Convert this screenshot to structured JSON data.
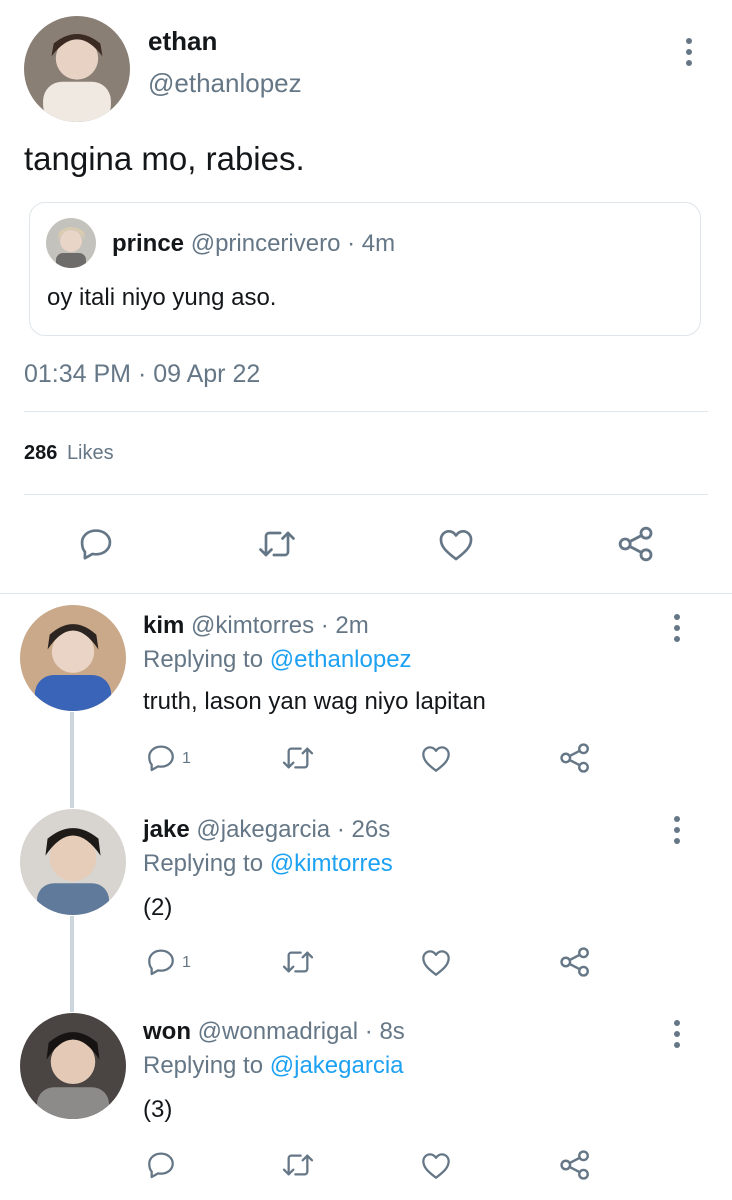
{
  "tweet": {
    "author_name": "ethan",
    "author_handle": "@ethanlopez",
    "text": "tangina mo, rabies.",
    "quote": {
      "author_name": "prince",
      "author_handle": "@princerivero",
      "separator": "·",
      "time": "4m",
      "text": "oy itali niyo yung aso."
    },
    "timestamp": "01:34 PM · 09 Apr 22",
    "likes_count": "286",
    "likes_label": "Likes",
    "actions": [
      "reply-icon",
      "retweet-icon",
      "like-icon",
      "share-icon"
    ]
  },
  "replies": [
    {
      "name": "kim",
      "handle": "@kimtorres",
      "separator": "·",
      "time": "2m",
      "replying_label": "Replying to",
      "replying_to": "@ethanlopez",
      "text": "truth, lason yan wag niyo lapitan",
      "reply_count": "1"
    },
    {
      "name": "jake",
      "handle": "@jakegarcia",
      "separator": "·",
      "time": "26s",
      "replying_label": "Replying to",
      "replying_to": "@kimtorres",
      "text": "(2)",
      "reply_count": "1"
    },
    {
      "name": "won",
      "handle": "@wonmadrigal",
      "separator": "·",
      "time": "8s",
      "replying_label": "Replying to",
      "replying_to": "@jakegarcia",
      "text": "(3)",
      "reply_count": ""
    }
  ],
  "colors": {
    "text": "#14171a",
    "secondary": "#657786",
    "link": "#1da1f2",
    "divider": "#e1e8ed",
    "thread": "#ccd6dd"
  }
}
